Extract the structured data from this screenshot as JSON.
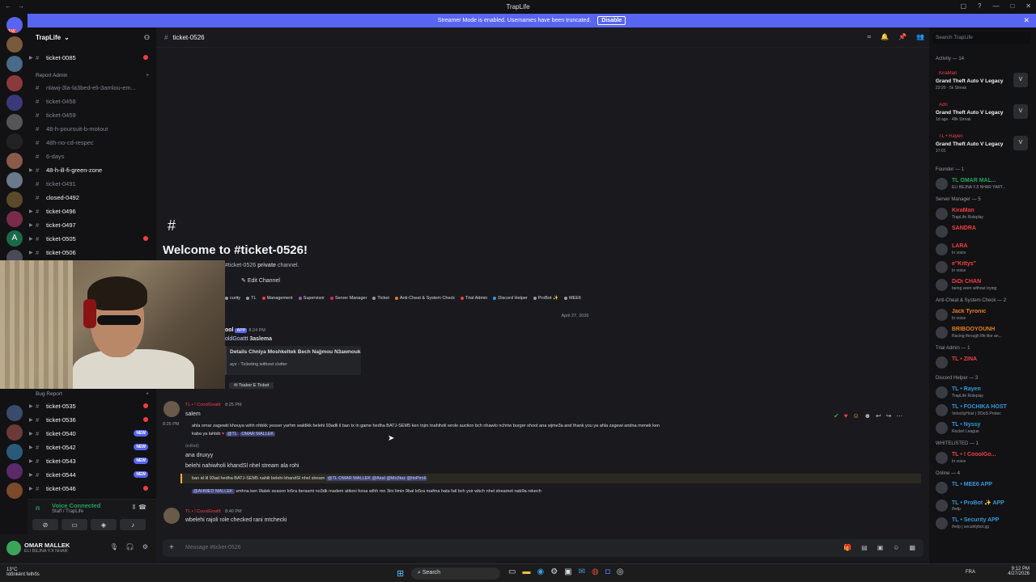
{
  "titlebar": {
    "title": "TrapLife"
  },
  "streamer": {
    "text": "Streamer Mode is enabled. Usernames have been truncated.",
    "button": "Disable"
  },
  "server": {
    "name": "TrapLife"
  },
  "channels": [
    {
      "name": "ticket-0085",
      "style": "bold",
      "caret": true,
      "badge": "unread"
    },
    {
      "name": "nlawj-3la-la3bed-eli-3amlou-em...",
      "style": "dim"
    },
    {
      "name": "ticket-0458",
      "style": "dim"
    },
    {
      "name": "ticket-0459",
      "style": "dim"
    },
    {
      "name": "48-h-poursuit-b-motour",
      "style": "dim"
    },
    {
      "name": "48h-no-cd-respec",
      "style": "dim"
    },
    {
      "name": "6-days",
      "style": "dim"
    },
    {
      "name": "48-h-ill-fi-green-zone",
      "style": "bold",
      "caret": true
    },
    {
      "name": "ticket-0491",
      "style": "dim"
    },
    {
      "name": "closed-0492",
      "style": "bold"
    },
    {
      "name": "ticket-0496",
      "style": "bold",
      "caret": true
    },
    {
      "name": "ticket-0497",
      "style": "bold",
      "caret": true
    },
    {
      "name": "ticket-0505",
      "style": "bold",
      "caret": true,
      "badge": "unread"
    },
    {
      "name": "ticket-0506",
      "style": "bold",
      "caret": true
    },
    {
      "name": "ticket-0535",
      "style": "bold",
      "caret": true,
      "badge": "unread"
    },
    {
      "name": "ticket-0536",
      "style": "bold",
      "caret": true,
      "badge": "unread"
    },
    {
      "name": "ticket-0540",
      "style": "bold",
      "caret": true,
      "badge": "new"
    },
    {
      "name": "ticket-0542",
      "style": "bold",
      "caret": true,
      "badge": "new"
    },
    {
      "name": "ticket-0543",
      "style": "bold",
      "caret": true,
      "badge": "new"
    },
    {
      "name": "ticket-0544",
      "style": "bold",
      "caret": true,
      "badge": "new"
    },
    {
      "name": "ticket-0546",
      "style": "bold",
      "caret": true,
      "badge": "unread"
    }
  ],
  "categories": {
    "report_admin": "Report Admin",
    "bug_report": "Bug Report"
  },
  "new_label": "NEW",
  "voice": {
    "status": "Voice Connected",
    "sub": "Staff / TrapLife"
  },
  "user": {
    "name": "OMAR MALLEK",
    "status": "ELI BEJNA YJI NHAR"
  },
  "channel_header": {
    "name": "ticket-0526"
  },
  "welcome": {
    "title": "Welcome to #ticket-0526!",
    "sub_prefix": "#ticket-0526",
    "sub_bold": "private",
    "sub_suffix": "channel.",
    "edit": "Edit Channel"
  },
  "roles": [
    {
      "name": "curity",
      "color": "#949ba4"
    },
    {
      "name": "TL",
      "color": "#949ba4"
    },
    {
      "name": "Management",
      "color": "#f23f43"
    },
    {
      "name": "Supervisor",
      "color": "#9b59b6"
    },
    {
      "name": "Server Manager",
      "color": "#e91e63"
    },
    {
      "name": "Ticket",
      "color": "#949ba4"
    },
    {
      "name": "Anti-Cheat & System Check",
      "color": "#e67e22"
    },
    {
      "name": "Trial Admin",
      "color": "#f23f43"
    },
    {
      "name": "Discord Helper",
      "color": "#3498db"
    },
    {
      "name": "ProBot ✨",
      "color": "#949ba4"
    },
    {
      "name": "MEE6",
      "color": "#949ba4"
    }
  ],
  "date_sep": "April 27, 2026",
  "messages": {
    "bot_name": "ool",
    "bot_app": "APP",
    "bot_time": "8:24 PM",
    "bot_reply_to": "oldGoattt",
    "bot_reply_text": "3aslema",
    "bot_embed_title": "Details Chniya Moshkeltek Bech Najjmou N3awnouk",
    "bot_embed_footer": "ayz - Ticketing without clutter",
    "bot_embed_button": "Tsaker E Ticket",
    "m1_author": "TL • ! CooolGoattt",
    "m1_time": "8:25 PM",
    "m1_line1": "salem",
    "m1_timestamp": "8:25 PM",
    "m1_line2": "ahla omar zagewiii khouya wihh nhbkk yesser yarhm waldikk belehi 93adli il ban tx in game hedha BATJ-SEM5 ken tnjm tnahiholi wrole auction bch nhawlo nchriw burger shoot ana wjme3a and thank you ya ahla zagewi andna menek ken",
    "m1_line3": "kaba ya lahbib",
    "m1_mention1": "@TL",
    "m1_mention1b": "OMAR MALLEK",
    "m1_edited": "(edited)",
    "m2_line1": "ana druxyy",
    "m2_line2": "belehi nahiwholi khandSl nhel stream ala rohi",
    "m3_line": "ban id lil 93ad hedha BATJ-SEM5 nahili belehi khandSl nhel stream",
    "m3_mentions": "@TL  OMAR MALLEK  @Asal  @Mo3taz  @ItsPiroli",
    "m4_mention": "@AHMED MALLEK",
    "m4_line": "smhna ken 9lalek season lo5ra berasmi no3dk madem atitoni forsa wlhh mn 3ini limin 9bal lo5ra mafma hata fail bch ysir wbch nhel streamet nab9a rekech",
    "m5_author": "TL • ! CooolGoattt",
    "m5_time": "8:40 PM",
    "m5_line": "wbelehi rajoli role checked rani mtchecki"
  },
  "input": {
    "placeholder": "Message #ticket-0526"
  },
  "members": {
    "search": "Search TrapLife",
    "activity_header": "Activity — 14",
    "activity": [
      {
        "name": "KiraMan",
        "game": "Grand Theft Auto V Legacy",
        "time": "23:20 · 5k Streak"
      },
      {
        "name": "Adri",
        "game": "Grand Theft Auto V Legacy",
        "time": "1d ago · 48k Streak"
      },
      {
        "name": "TL • Rayen",
        "game": "Grand Theft Auto V Legacy",
        "time": "17:01"
      }
    ],
    "groups": [
      {
        "header": "Founder — 1",
        "items": [
          {
            "name": "TL OMAR MAL...",
            "status": "ELI BEJNA YJI NHAR YART...",
            "color": "#23a55a"
          }
        ]
      },
      {
        "header": "Server Manager — 5",
        "items": [
          {
            "name": "KiraMan",
            "status": "TrapLife Roleplay",
            "color": "#f23f43"
          },
          {
            "name": "SANDRA",
            "status": "",
            "color": "#f23f43"
          },
          {
            "name": "LARA",
            "status": "In voice",
            "color": "#f23f43"
          },
          {
            "name": "e\"Kittys\"",
            "status": "In voice",
            "color": "#f23f43"
          },
          {
            "name": "DiDi CHAN",
            "status": "being seen without trying",
            "color": "#f23f43"
          }
        ]
      },
      {
        "header": "Anti-Cheat & System Check — 2",
        "items": [
          {
            "name": "Jack Tyronic",
            "status": "In voice",
            "color": "#e67e22"
          },
          {
            "name": "BRIBOOYOUNH",
            "status": "Racing through life like an...",
            "color": "#e67e22"
          }
        ]
      },
      {
        "header": "Trial Admin — 1",
        "items": [
          {
            "name": "TL • ZINA",
            "status": "",
            "color": "#f23f43"
          }
        ]
      },
      {
        "header": "Discord Helper — 3",
        "items": [
          {
            "name": "TL • Rayen",
            "status": "TrapLife Roleplay",
            "color": "#3498db"
          },
          {
            "name": "TL • FOCHIKA HOST",
            "status": "VelocityHost | DDoS Protec",
            "color": "#3498db"
          },
          {
            "name": "TL • Nyssy",
            "status": "Rocket League",
            "color": "#3498db"
          }
        ]
      },
      {
        "header": "WHITELISTED — 1",
        "items": [
          {
            "name": "TL • ! CooolGo...",
            "status": "In voice",
            "color": "#f23f43"
          }
        ]
      },
      {
        "header": "Online — 4",
        "items": [
          {
            "name": "TL • MEE6 APP",
            "status": "",
            "color": "#3498db"
          },
          {
            "name": "TL • ProBot ✨ APP",
            "status": "/help",
            "color": "#3498db"
          },
          {
            "name": "TL • Security APP",
            "status": "/help | securitybot.gg",
            "color": "#3498db"
          }
        ]
      }
    ]
  },
  "taskbar": {
    "weather_temp": "13°C",
    "weather_desc": "Időnként felhős",
    "search": "Search",
    "lang": "FRA",
    "time": "9:12 PM",
    "date": "4/27/2026"
  }
}
